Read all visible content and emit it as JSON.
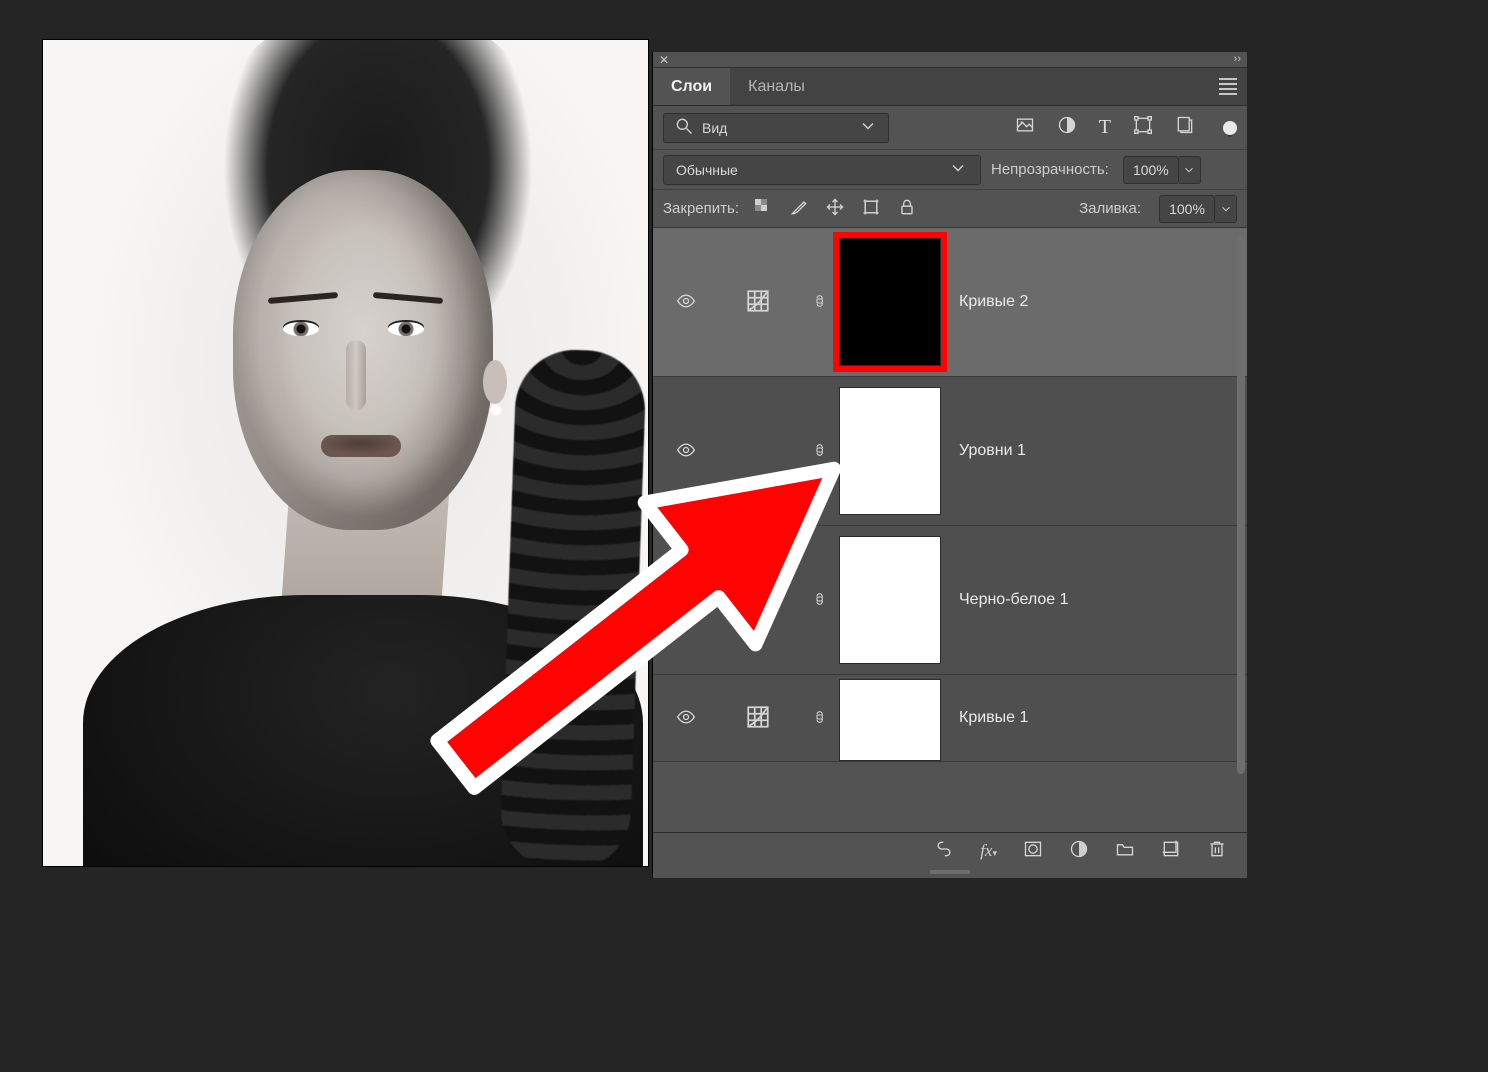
{
  "tabs": {
    "layers": "Слои",
    "channels": "Каналы"
  },
  "filter": {
    "label": "Вид",
    "placeholder": "Вид"
  },
  "blend": {
    "mode": "Обычные",
    "opacity_label": "Непрозрачность:",
    "opacity_value": "100%"
  },
  "lock": {
    "label": "Закрепить:",
    "fill_label": "Заливка:",
    "fill_value": "100%"
  },
  "layers_list": [
    {
      "name": "Кривые 2",
      "adj_icon": "curves",
      "mask": "black",
      "selected": true,
      "highlight": true,
      "visible": true
    },
    {
      "name": "Уровни 1",
      "adj_icon": "none",
      "mask": "white",
      "selected": false,
      "highlight": false,
      "visible": true
    },
    {
      "name": "Черно-белое 1",
      "adj_icon": "halfsquare",
      "mask": "white",
      "selected": false,
      "highlight": false,
      "visible": true
    },
    {
      "name": "Кривые 1",
      "adj_icon": "curves",
      "mask": "white",
      "selected": false,
      "highlight": false,
      "visible": true
    }
  ],
  "icons": {
    "image": "image-icon",
    "circle_half": "mask-circle-icon",
    "type": "T",
    "transform": "transform-icon",
    "artboard": "artboard-icon"
  }
}
